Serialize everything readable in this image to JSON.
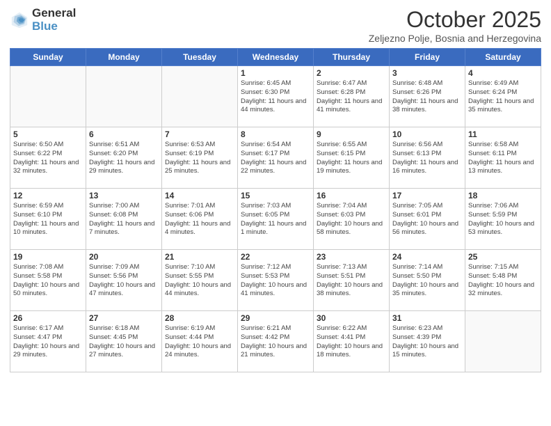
{
  "logo": {
    "general": "General",
    "blue": "Blue",
    "icon_title": "GeneralBlue logo"
  },
  "header": {
    "month_title": "October 2025",
    "subtitle": "Zeljezno Polje, Bosnia and Herzegovina"
  },
  "weekdays": [
    "Sunday",
    "Monday",
    "Tuesday",
    "Wednesday",
    "Thursday",
    "Friday",
    "Saturday"
  ],
  "rows": [
    [
      {
        "day": "",
        "info": ""
      },
      {
        "day": "",
        "info": ""
      },
      {
        "day": "",
        "info": ""
      },
      {
        "day": "1",
        "info": "Sunrise: 6:45 AM\nSunset: 6:30 PM\nDaylight: 11 hours and 44 minutes."
      },
      {
        "day": "2",
        "info": "Sunrise: 6:47 AM\nSunset: 6:28 PM\nDaylight: 11 hours and 41 minutes."
      },
      {
        "day": "3",
        "info": "Sunrise: 6:48 AM\nSunset: 6:26 PM\nDaylight: 11 hours and 38 minutes."
      },
      {
        "day": "4",
        "info": "Sunrise: 6:49 AM\nSunset: 6:24 PM\nDaylight: 11 hours and 35 minutes."
      }
    ],
    [
      {
        "day": "5",
        "info": "Sunrise: 6:50 AM\nSunset: 6:22 PM\nDaylight: 11 hours and 32 minutes."
      },
      {
        "day": "6",
        "info": "Sunrise: 6:51 AM\nSunset: 6:20 PM\nDaylight: 11 hours and 29 minutes."
      },
      {
        "day": "7",
        "info": "Sunrise: 6:53 AM\nSunset: 6:19 PM\nDaylight: 11 hours and 25 minutes."
      },
      {
        "day": "8",
        "info": "Sunrise: 6:54 AM\nSunset: 6:17 PM\nDaylight: 11 hours and 22 minutes."
      },
      {
        "day": "9",
        "info": "Sunrise: 6:55 AM\nSunset: 6:15 PM\nDaylight: 11 hours and 19 minutes."
      },
      {
        "day": "10",
        "info": "Sunrise: 6:56 AM\nSunset: 6:13 PM\nDaylight: 11 hours and 16 minutes."
      },
      {
        "day": "11",
        "info": "Sunrise: 6:58 AM\nSunset: 6:11 PM\nDaylight: 11 hours and 13 minutes."
      }
    ],
    [
      {
        "day": "12",
        "info": "Sunrise: 6:59 AM\nSunset: 6:10 PM\nDaylight: 11 hours and 10 minutes."
      },
      {
        "day": "13",
        "info": "Sunrise: 7:00 AM\nSunset: 6:08 PM\nDaylight: 11 hours and 7 minutes."
      },
      {
        "day": "14",
        "info": "Sunrise: 7:01 AM\nSunset: 6:06 PM\nDaylight: 11 hours and 4 minutes."
      },
      {
        "day": "15",
        "info": "Sunrise: 7:03 AM\nSunset: 6:05 PM\nDaylight: 11 hours and 1 minute."
      },
      {
        "day": "16",
        "info": "Sunrise: 7:04 AM\nSunset: 6:03 PM\nDaylight: 10 hours and 58 minutes."
      },
      {
        "day": "17",
        "info": "Sunrise: 7:05 AM\nSunset: 6:01 PM\nDaylight: 10 hours and 56 minutes."
      },
      {
        "day": "18",
        "info": "Sunrise: 7:06 AM\nSunset: 5:59 PM\nDaylight: 10 hours and 53 minutes."
      }
    ],
    [
      {
        "day": "19",
        "info": "Sunrise: 7:08 AM\nSunset: 5:58 PM\nDaylight: 10 hours and 50 minutes."
      },
      {
        "day": "20",
        "info": "Sunrise: 7:09 AM\nSunset: 5:56 PM\nDaylight: 10 hours and 47 minutes."
      },
      {
        "day": "21",
        "info": "Sunrise: 7:10 AM\nSunset: 5:55 PM\nDaylight: 10 hours and 44 minutes."
      },
      {
        "day": "22",
        "info": "Sunrise: 7:12 AM\nSunset: 5:53 PM\nDaylight: 10 hours and 41 minutes."
      },
      {
        "day": "23",
        "info": "Sunrise: 7:13 AM\nSunset: 5:51 PM\nDaylight: 10 hours and 38 minutes."
      },
      {
        "day": "24",
        "info": "Sunrise: 7:14 AM\nSunset: 5:50 PM\nDaylight: 10 hours and 35 minutes."
      },
      {
        "day": "25",
        "info": "Sunrise: 7:15 AM\nSunset: 5:48 PM\nDaylight: 10 hours and 32 minutes."
      }
    ],
    [
      {
        "day": "26",
        "info": "Sunrise: 6:17 AM\nSunset: 4:47 PM\nDaylight: 10 hours and 29 minutes."
      },
      {
        "day": "27",
        "info": "Sunrise: 6:18 AM\nSunset: 4:45 PM\nDaylight: 10 hours and 27 minutes."
      },
      {
        "day": "28",
        "info": "Sunrise: 6:19 AM\nSunset: 4:44 PM\nDaylight: 10 hours and 24 minutes."
      },
      {
        "day": "29",
        "info": "Sunrise: 6:21 AM\nSunset: 4:42 PM\nDaylight: 10 hours and 21 minutes."
      },
      {
        "day": "30",
        "info": "Sunrise: 6:22 AM\nSunset: 4:41 PM\nDaylight: 10 hours and 18 minutes."
      },
      {
        "day": "31",
        "info": "Sunrise: 6:23 AM\nSunset: 4:39 PM\nDaylight: 10 hours and 15 minutes."
      },
      {
        "day": "",
        "info": ""
      }
    ]
  ]
}
